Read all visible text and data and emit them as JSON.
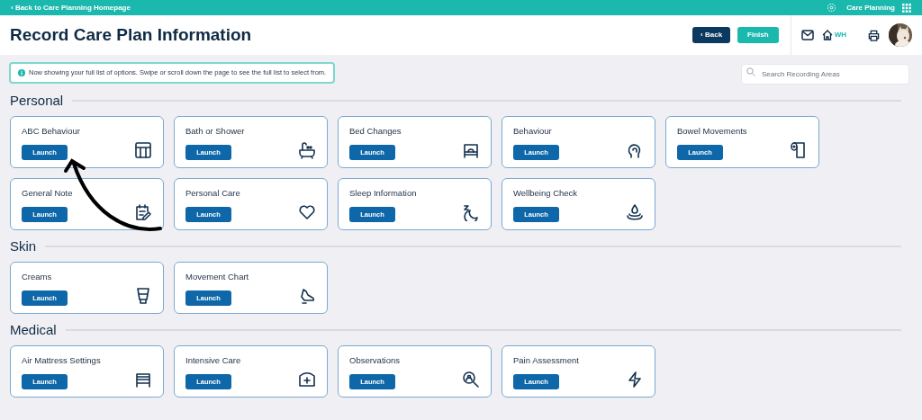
{
  "top_bar": {
    "back_link": "‹ Back to Care Planning Homepage",
    "app_name": "Care Planning"
  },
  "header": {
    "title": "Record Care Plan Information",
    "back_button": "‹ Back",
    "finish_button": "Finish",
    "home_label": "WH"
  },
  "notice": "Now showing your full list of options. Swipe or scroll down the page to see the full list to select from.",
  "search": {
    "placeholder": "Search Recording Areas"
  },
  "sections": [
    {
      "title": "Personal",
      "cards": [
        {
          "title": "ABC Behaviour",
          "button": "Launch"
        },
        {
          "title": "Bath or Shower",
          "button": "Launch"
        },
        {
          "title": "Bed Changes",
          "button": "Launch"
        },
        {
          "title": "Behaviour",
          "button": "Launch"
        },
        {
          "title": "Bowel Movements",
          "button": "Launch"
        },
        {
          "title": "General Note",
          "button": "Launch"
        },
        {
          "title": "Personal Care",
          "button": "Launch"
        },
        {
          "title": "Sleep Information",
          "button": "Launch"
        },
        {
          "title": "Wellbeing Check",
          "button": "Launch"
        }
      ]
    },
    {
      "title": "Skin",
      "cards": [
        {
          "title": "Creams",
          "button": "Launch"
        },
        {
          "title": "Movement Chart",
          "button": "Launch"
        }
      ]
    },
    {
      "title": "Medical",
      "cards": [
        {
          "title": "Air Mattress Settings",
          "button": "Launch"
        },
        {
          "title": "Intensive Care",
          "button": "Launch"
        },
        {
          "title": "Observations",
          "button": "Launch"
        },
        {
          "title": "Pain Assessment",
          "button": "Launch"
        }
      ]
    }
  ]
}
